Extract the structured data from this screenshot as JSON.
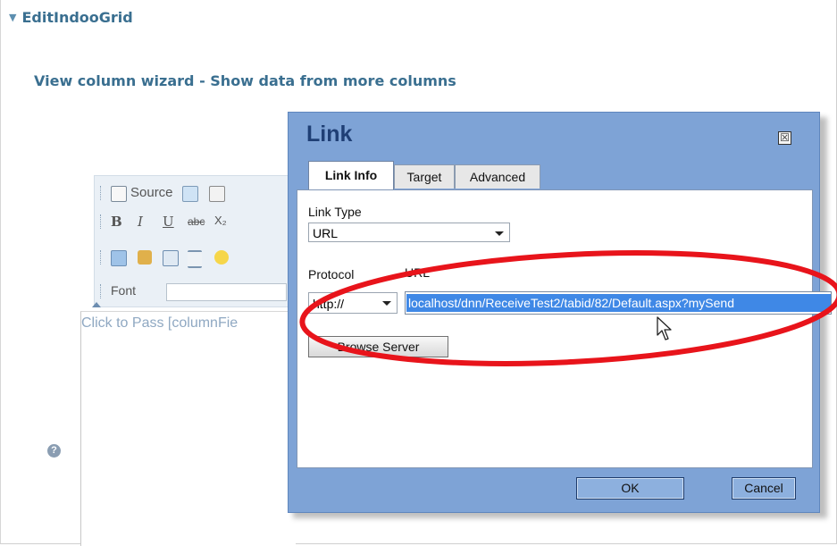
{
  "page": {
    "section_title": "EditIndooGrid",
    "wizard_title": "View column wizard - Show data from more columns"
  },
  "editor": {
    "toolbar": {
      "source_label": "Source",
      "font_label": "Font",
      "format_buttons": [
        "B",
        "I",
        "U",
        "abc",
        "X₂"
      ]
    },
    "placeholder": "Click to Pass [columnFie"
  },
  "dialog": {
    "title": "Link",
    "close_symbol": "☒",
    "tabs": [
      {
        "label": "Link Info",
        "active": true
      },
      {
        "label": "Target",
        "active": false
      },
      {
        "label": "Advanced",
        "active": false
      }
    ],
    "link_type_label": "Link Type",
    "link_type_value": "URL",
    "protocol_label": "Protocol",
    "protocol_value": "http://",
    "url_label": "URL",
    "url_value": "localhost/dnn/ReceiveTest2/tabid/82/Default.aspx?mySend",
    "browse_button": "Browse Server",
    "ok_button": "OK",
    "cancel_button": "Cancel"
  },
  "colors": {
    "heading": "#3a6f90",
    "dialog_bg": "#7ea3d6",
    "selection": "#3f88e6",
    "highlight_ellipse": "#e8141b"
  }
}
